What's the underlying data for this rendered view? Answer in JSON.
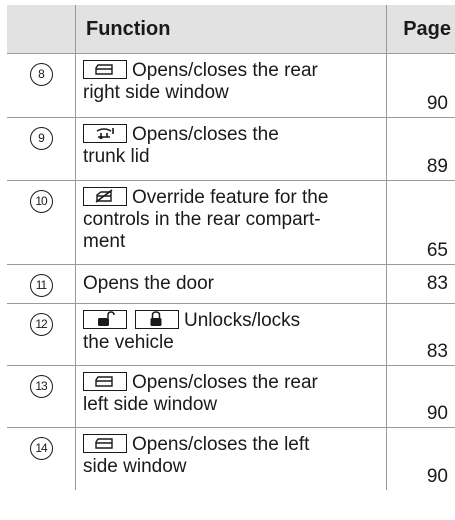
{
  "header": {
    "function": "Function",
    "page": "Page"
  },
  "rows": [
    {
      "marker": "8",
      "text_lines": [
        "Opens/closes the rear",
        "right side window"
      ],
      "page": "90",
      "icons": [
        "rear-window-switch-icon"
      ]
    },
    {
      "marker": "9",
      "text_lines": [
        "Opens/closes the",
        "trunk lid"
      ],
      "page": "89",
      "icons": [
        "trunk-lid-switch-icon"
      ]
    },
    {
      "marker": "10",
      "text_lines": [
        "Override feature for the",
        "controls in the rear compart-",
        "ment"
      ],
      "page": "65",
      "icons": [
        "rear-controls-override-icon"
      ]
    },
    {
      "marker": "11",
      "text_lines": [
        "Opens the door"
      ],
      "page": "83",
      "icons": []
    },
    {
      "marker": "12",
      "text_lines": [
        "Unlocks/locks",
        "the vehicle"
      ],
      "page": "83",
      "icons": [
        "unlock-icon",
        "lock-icon"
      ]
    },
    {
      "marker": "13",
      "text_lines": [
        "Opens/closes the rear",
        "left side window"
      ],
      "page": "90",
      "icons": [
        "rear-window-switch-icon"
      ]
    },
    {
      "marker": "14",
      "text_lines": [
        "Opens/closes the left",
        "side window"
      ],
      "page": "90",
      "icons": [
        "window-switch-icon"
      ]
    }
  ]
}
